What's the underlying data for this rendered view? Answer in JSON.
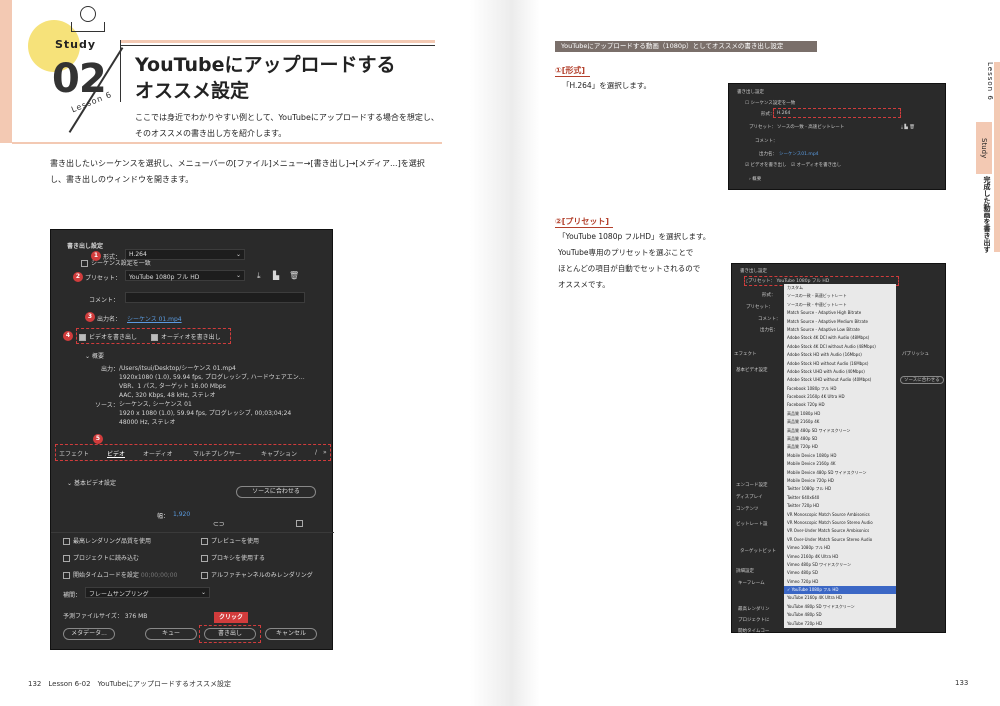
{
  "left_page": {
    "study_label": "Study",
    "lesson_number": "02",
    "lesson_sub": "Lesson 6",
    "title_line1": "YouTubeにアップロードする",
    "title_line2": "オススメ設定",
    "intro_line1": "ここでは身近でわかりやすい例として、YouTubeにアップロードする場合を想定し、",
    "intro_line2": "そのオススメの書き出し方を紹介します。",
    "body_line1": "書き出したいシーケンスを選択し、メニューバーの[ファイル]メニュー→[書き出し]→[メディア...]を選択",
    "body_line2": "し、書き出しのウィンドウを開きます。",
    "click_tag": "クリック",
    "footer": "132　Lesson 6-02　YouTubeにアップロードするオススメ設定"
  },
  "dialog": {
    "section_export": "書き出し設定",
    "match_sequence": "シーケンス設定を一致",
    "format_label": "形式：",
    "format_value": "H.264",
    "preset_label": "プリセット：",
    "preset_value": "YouTube 1080p フル HD",
    "comment_label": "コメント：",
    "output_label": "出力名：",
    "output_value": "シーケンス 01.mp4",
    "export_video": "ビデオを書き出し",
    "export_audio": "オーディオを書き出し",
    "summary": "概要",
    "out_label": "出力：",
    "out_lines": [
      "/Users/itsui/Desktop/シーケンス 01.mp4",
      "1920x1080 (1.0), 59.94 fps, プログレッシブ, ハードウェアエン…",
      "VBR、1 パス, ターゲット 16.00 Mbps",
      "AAC, 320 Kbps, 48 kHz, ステレオ"
    ],
    "src_label": "ソース：",
    "src_lines": [
      "シーケンス, シーケンス 01",
      "1920 x 1080 (1.0), 59.94 fps, プログレッシブ, 00;03;04;24",
      "48000 Hz, ステレオ"
    ],
    "tabs": [
      "エフェクト",
      "ビデオ",
      "オーディオ",
      "マルチプレクサー",
      "キャプション",
      "/"
    ],
    "basic_video": "基本ビデオ設定",
    "match_source": "ソースに合わせる",
    "width_label": "幅：",
    "width_value": "1,920",
    "opt_max_render": "最高レンダリング品質を使用",
    "opt_preview": "プレビューを使用",
    "opt_import": "プロジェクトに読み込む",
    "opt_proxy": "プロキシを使用する",
    "opt_start_tc": "開始タイムコードを設定",
    "opt_start_tc_val": "00;00;00;00",
    "opt_alpha": "アルファチャンネルのみレンダリング",
    "interp_label": "補間：",
    "interp_value": "フレームサンプリング",
    "filesize": "予測ファイルサイズ：  376 MB",
    "btn_metadata": "メタデータ...",
    "btn_queue": "キュー",
    "btn_export": "書き出し",
    "btn_cancel": "キャンセル",
    "markers": [
      "1",
      "2",
      "3",
      "4",
      "5"
    ]
  },
  "right_page": {
    "heading": "YouTubeにアップロードする動画（1080p）としてオススメの書き出し設定",
    "step1_title": "①[形式]",
    "step1_text": "「H.264」を選択します。",
    "step2_title": "②[プリセット]",
    "step2_text": [
      "「YouTube 1080p フルHD」を選択します。",
      "YouTube専用のプリセットを選ぶことで",
      "ほとんどの項目が自動でセットされるので",
      "オススメです。"
    ],
    "side_lesson": "Lesson 6",
    "side_study": "Study",
    "side_title": "完成した動画を書き出す",
    "footer": "133"
  },
  "shot1": {
    "title": "書き出し設定",
    "match": "シーケンス設定を一致",
    "format_label": "形式：",
    "format_value": "H.264",
    "preset_label": "プリセット：",
    "preset_value": "ソースの一致 - 高速ビットレート",
    "comment_label": "コメント：",
    "output_label": "出力名：",
    "output_value": "シーケンス01.mp4",
    "export_video": "ビデオを書き出し",
    "export_audio": "オーディオを書き出し",
    "summary": "概要"
  },
  "shot2": {
    "title": "書き出し設定",
    "match": "シーケンス設定を一致",
    "format_label": "形式：",
    "format_value": "H.264",
    "preset_label": "プリセット：",
    "preset_value": "YouTube 1080p フル HD",
    "comment_label": "コメント：",
    "output_label": "出力名：",
    "tab_label": "エフェクト",
    "tab_multiplexer": "マルチプレ",
    "tab_caption": "パブリッシュ",
    "basic_video": "基本ビデオ設定",
    "match_source_btn": "ソースに合わせる",
    "encode": "エンコード設定",
    "display": "ディスプレイ",
    "content": "コンテンツ",
    "bitrate": "ビットレート設",
    "target": "ターゲットビット",
    "advanced": "詳細設定",
    "keyframe": "キーフレーム",
    "max_render": "最高レンダリン",
    "import": "プロジェクトに",
    "start_tc": "開始タイムコー",
    "list": [
      "カスタム",
      "ソースの一致 - 高速ビットレート",
      "ソースの一致 - 中速ビットレート",
      "Match Source - Adaptive High Bitrate",
      "Match Source - Adaptive Medium Bitrate",
      "Match Source - Adaptive Low Bitrate",
      "Adobe Stock 4K DCI with Audio (48Mbps)",
      "Adobe Stock 4K DCI without Audio (48Mbps)",
      "Adobe Stock HD with Audio (16Mbps)",
      "Adobe Stock HD without Audio (16Mbps)",
      "Adobe Stock UHD with Audio (40Mbps)",
      "Adobe Stock UHD without Audio (40Mbps)",
      "Facebook 1080p フル HD",
      "Facebook 2160p 4K Ultra HD",
      "Facebook 720p HD",
      "高品質 1080p HD",
      "高品質 2160p 4K",
      "高品質 480p SD ワイドスクリーン",
      "高品質 480p SD",
      "高品質 720p HD",
      "Mobile Device 1080p HD",
      "Mobile Device 2160p 4K",
      "Mobile Device 480p SD ワイドスクリーン",
      "Mobile Device 720p HD",
      "Twitter 1080p フル HD",
      "Twitter 640x640",
      "Twitter 720p HD",
      "VR Monoscopic Match Source Ambisonics",
      "VR Monoscopic Match Source Stereo Audio",
      "VR Over-Under Match Source Ambisonics",
      "VR Over-Under Match Source Stereo Audio",
      "Vimeo 1080p フル HD",
      "Vimeo 2160p 4K Ultra HD",
      "Vimeo 480p SD ワイドスクリーン",
      "Vimeo 480p SD",
      "Vimeo 720p HD",
      "✓ YouTube 1080p フル HD",
      "YouTube 2160p 4K Ultra HD",
      "YouTube 480p SD ワイドスクリーン",
      "YouTube 480p SD",
      "YouTube 720p HD"
    ],
    "highlight_index": 36
  },
  "colors": {
    "accent_peach": "#f3c9b3",
    "accent_red": "#d13c3c",
    "heading_gray": "#7a6f6a",
    "dialog_bg": "#2a2a2a",
    "highlight_blue": "#3b67c5"
  }
}
